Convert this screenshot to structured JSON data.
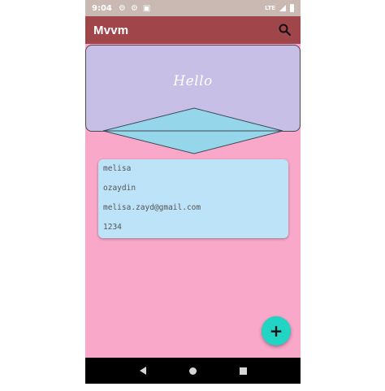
{
  "status_bar": {
    "time": "9:04",
    "network": "LTE"
  },
  "app_bar": {
    "title": "Mvvm",
    "icon": "search-icon"
  },
  "header": {
    "greeting": "Hello"
  },
  "user_card": {
    "first_name": "melisa",
    "last_name": "ozaydin",
    "email": "melisa.zayd@gmail.com",
    "number": "1234"
  },
  "fab": {
    "label": "+"
  },
  "colors": {
    "background": "#f9a8c9",
    "app_bar": "#a0464b",
    "header_card": "#c8bfe6",
    "diamond": "#96d6ea",
    "info_card": "#bde3f8",
    "fab": "#21d4c4"
  }
}
